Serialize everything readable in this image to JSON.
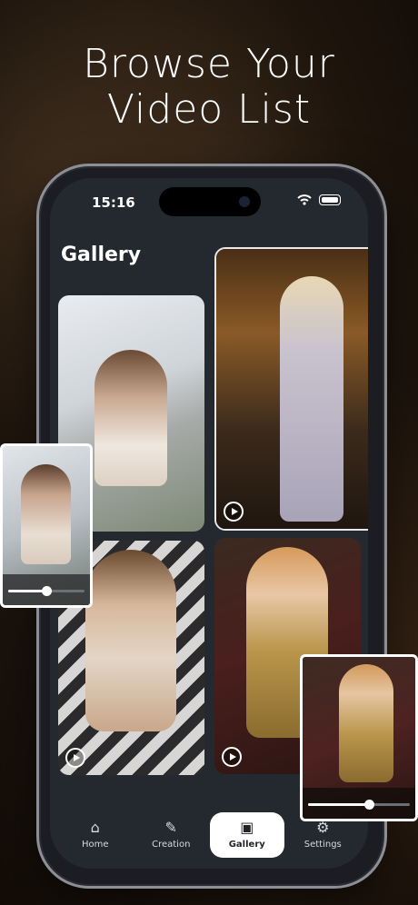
{
  "promo": {
    "headline_line1": "Browse Your",
    "headline_line2": "Video List"
  },
  "status_bar": {
    "time": "15:16"
  },
  "page": {
    "title": "Gallery"
  },
  "gallery": {
    "items": [
      {
        "name": "video-card-1",
        "has_play": false
      },
      {
        "name": "video-card-2",
        "has_play": true
      },
      {
        "name": "video-card-3",
        "has_play": true
      },
      {
        "name": "video-card-4",
        "has_play": true
      }
    ]
  },
  "previews": {
    "left_progress": 0.5,
    "right_progress": 0.6
  },
  "nav": {
    "items": [
      {
        "label": "Home",
        "icon": "home-icon"
      },
      {
        "label": "Creation",
        "icon": "brush-icon"
      },
      {
        "label": "Gallery",
        "icon": "gallery-icon"
      },
      {
        "label": "Settings",
        "icon": "gear-icon"
      }
    ],
    "active": "Gallery"
  },
  "colors": {
    "accent": "#ffffff",
    "screen_bg": "#24282f",
    "nav_active_bg": "#ffffff"
  }
}
